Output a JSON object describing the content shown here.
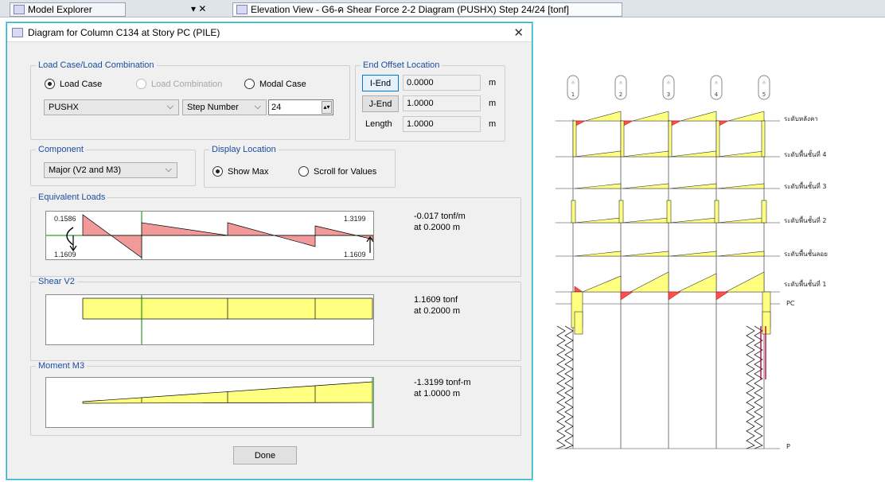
{
  "tabs": {
    "explorer": "Model Explorer",
    "explorer_ctrl": "▾ ✕",
    "elevation": "Elevation View - G6-ค   Shear Force 2-2 Diagram   (PUSHX)  Step 24/24  [tonf]"
  },
  "dialog": {
    "title": "Diagram for Column C134 at Story PC (PILE)",
    "close": "✕",
    "load_group": {
      "label": "Load Case/Load Combination",
      "radio_load_case": "Load Case",
      "radio_load_combination": "Load Combination",
      "radio_modal_case": "Modal Case",
      "case_value": "PUSHX",
      "step_select": "Step Number",
      "step_value": "24"
    },
    "end_offset": {
      "label": "End Offset Location",
      "i_end_button": "I-End",
      "i_end_value": "0.0000",
      "j_end_button": "J-End",
      "j_end_value": "1.0000",
      "length_label": "Length",
      "length_value": "1.0000",
      "unit": "m"
    },
    "component": {
      "label": "Component",
      "value": "Major (V2 and M3)"
    },
    "display_location": {
      "label": "Display Location",
      "show_max": "Show Max",
      "scroll_values": "Scroll for Values"
    },
    "equivalent_loads": {
      "label": "Equivalent Loads",
      "top_left": "0.1586",
      "top_right": "1.3199",
      "bottom_left": "1.1609",
      "bottom_right": "1.1609",
      "value_line1": "-0.017 tonf/m",
      "value_line2": "at 0.2000 m"
    },
    "shear": {
      "label": "Shear V2",
      "value_line1": "1.1609 tonf",
      "value_line2": "at 0.2000 m"
    },
    "moment": {
      "label": "Moment M3",
      "value_line1": "-1.3199 tonf-m",
      "value_line2": "at 1.0000 m"
    },
    "done": "Done"
  },
  "elevation": {
    "grid_labels": [
      "1",
      "2",
      "3",
      "4",
      "5"
    ],
    "grid_top_letter": "ก",
    "stories": [
      "ระดับหลังคา",
      "ระดับพื้นชั้นที่ 4",
      "ระดับพื้นชั้นที่ 3",
      "ระดับพื้นชั้นที่ 2",
      "ระดับพื้นชั้นลอย",
      "ระดับพื้นชั้นที่ 1",
      "PC",
      "P"
    ]
  },
  "colors": {
    "accent": "#24b1c9",
    "group_label": "#1a4ea3",
    "diagram_fill": "#ffff80",
    "diagram_red": "#f29a9a",
    "diagram_line": "#008000"
  }
}
